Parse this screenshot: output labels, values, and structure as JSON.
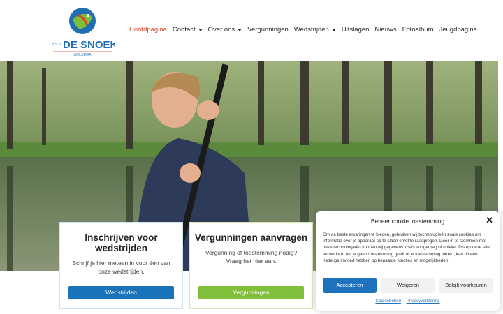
{
  "logo": {
    "top_text": "H.S.V.",
    "name": "DE SNOEK",
    "sub": "WOLVEGA",
    "colors": {
      "blue": "#1f6fb2",
      "green": "#7cbf3a",
      "red": "#d9472b"
    }
  },
  "nav": {
    "items": [
      {
        "label": "Hoofdpagina",
        "active": true,
        "dropdown": false
      },
      {
        "label": "Contact",
        "active": false,
        "dropdown": true
      },
      {
        "label": "Over ons",
        "active": false,
        "dropdown": true
      },
      {
        "label": "Vergunningen",
        "active": false,
        "dropdown": false
      },
      {
        "label": "Wedstrijden",
        "active": false,
        "dropdown": true
      },
      {
        "label": "Uitslagen",
        "active": false,
        "dropdown": false
      },
      {
        "label": "Nieuws",
        "active": false,
        "dropdown": false
      },
      {
        "label": "Fotoalbum",
        "active": false,
        "dropdown": false
      },
      {
        "label": "Jeugdpagina",
        "active": false,
        "dropdown": false
      }
    ]
  },
  "cards": [
    {
      "title": "Inschrijven voor wedstrijden",
      "text": "Schrijf je hier meteen in voor één van onze wedstrijden.",
      "button": "Wedstrijden",
      "button_color": "#1a72b8"
    },
    {
      "title": "Vergunningen aanvragen",
      "text": "Vergunning of toestemming nodig? Vraag het hier aan.",
      "button": "Vergunningen",
      "button_color": "#7fbf3a"
    }
  ],
  "cookie": {
    "title": "Beheer cookie toestemming",
    "close_icon": "close-icon",
    "body": "Om de beste ervaringen te bieden, gebruiken wij technologieën zoals cookies om informatie over je apparaat op te slaan en/of te raadplegen. Door in te stemmen met deze technologieën kunnen wij gegevens zoals surfgedrag of unieke ID's op deze site verwerken. Als je geen toestemming geeft of je toestemming intrekt, kan dit een nadelige invloed hebben op bepaalde functies en mogelijkheden.",
    "accept": "Accepteren",
    "deny": "Weigeren",
    "preferences": "Bekijk voorkeuren",
    "links": [
      "Cookiebeleid",
      "Privacyverklaring"
    ]
  }
}
